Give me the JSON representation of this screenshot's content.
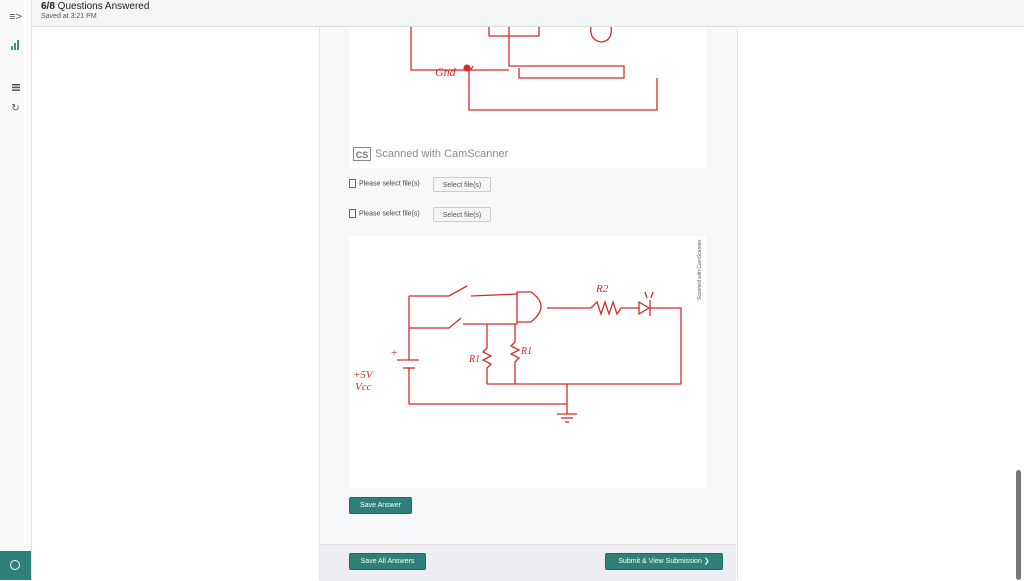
{
  "header": {
    "progress_count": "6/8",
    "progress_label": " Questions Answered",
    "saved_text": "Saved at 3:21 PM"
  },
  "sidebar": {
    "icons": [
      "menu-arrow-icon",
      "bar-chart-icon",
      "list-icon",
      "refresh-icon",
      "user-circle-icon"
    ],
    "menu_glyph": "≡>",
    "refresh_glyph": "↻"
  },
  "answer": {
    "image1": {
      "cam_logo": "CS",
      "cam_text": "Scanned with CamScanner",
      "gnd_label": "Gnd"
    },
    "file_inputs": [
      {
        "label": "Please select file(s)",
        "button": "Select file(s)"
      },
      {
        "label": "Please select file(s)",
        "button": "Select file(s)"
      }
    ],
    "image2": {
      "labels": {
        "r2": "R2",
        "r1_left": "R1",
        "r1_right": "R1",
        "supply_top": "+5V",
        "supply_bottom": "Vcc",
        "plus": "+"
      },
      "vertical_text": "Scanned with CamScanner"
    },
    "save_answer_label": "Save Answer"
  },
  "footer": {
    "save_all_label": "Save All Answers",
    "submit_label": "Submit & View Submission ❯"
  },
  "colors": {
    "accent": "#2f7f7a",
    "ink": "#d42b2b"
  }
}
